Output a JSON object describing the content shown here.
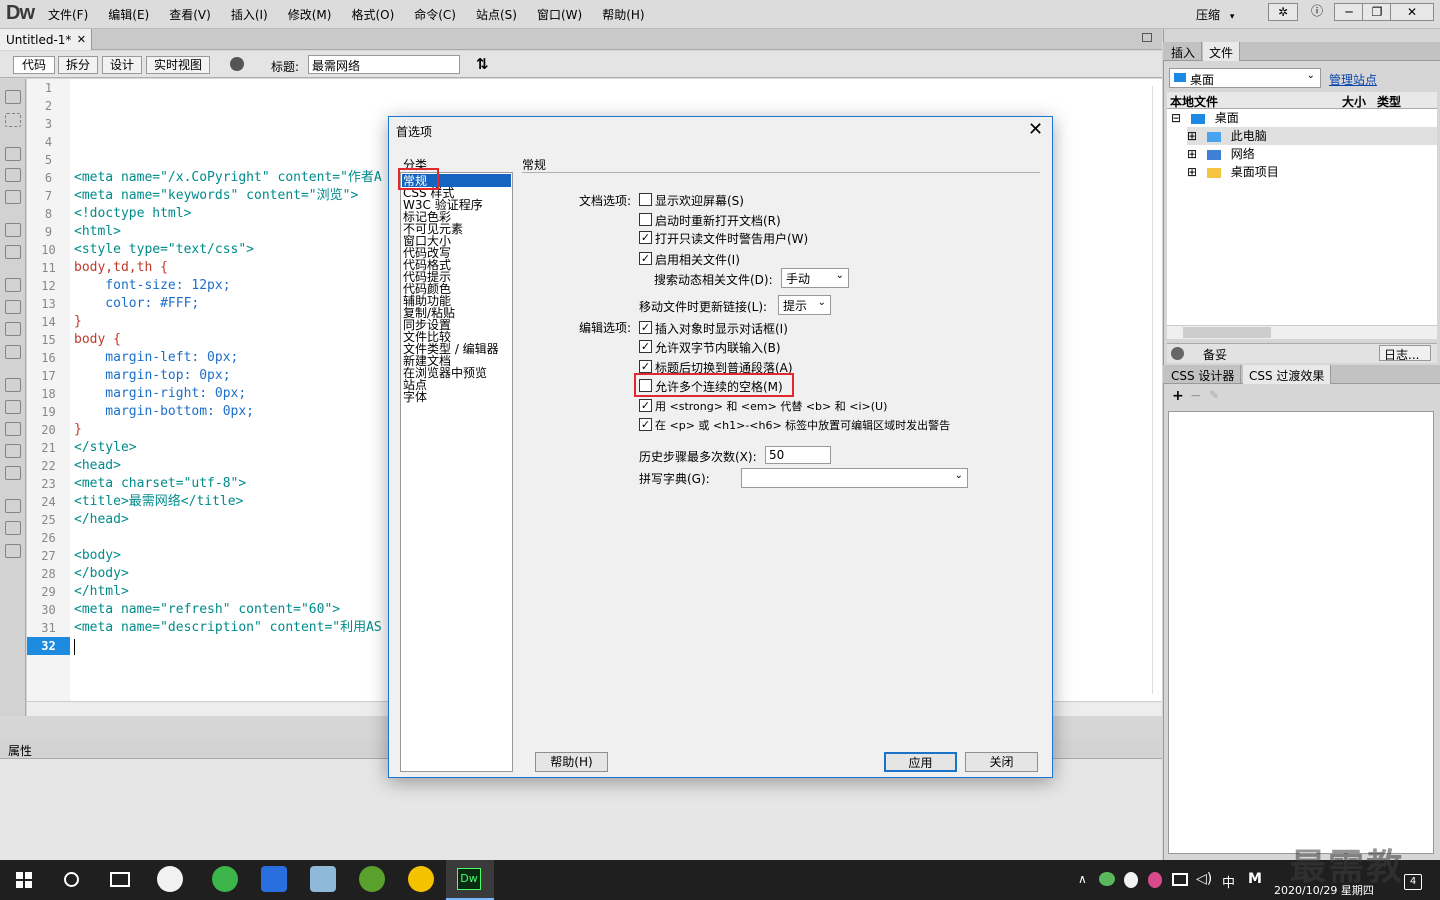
{
  "app": {
    "logo": "Dw",
    "menus": [
      "文件(F)",
      "编辑(E)",
      "查看(V)",
      "插入(I)",
      "修改(M)",
      "格式(O)",
      "命令(C)",
      "站点(S)",
      "窗口(W)",
      "帮助(H)"
    ],
    "compress_label": "压缩",
    "compress_arrow": "▾",
    "window_btns": [
      "✲",
      "ⓘ",
      "─",
      "❐",
      "✕"
    ]
  },
  "document": {
    "tab_name": "Untitled-1*",
    "tab_close": "✕",
    "view_buttons": [
      "代码",
      "拆分",
      "设计",
      "实时视图"
    ],
    "title_label": "标题:",
    "title_value": "最需网络"
  },
  "editor": {
    "line_numbers": [
      "1",
      "2",
      "3",
      "4",
      "5",
      "6",
      "7",
      "8",
      "9",
      "10",
      "11",
      "12",
      "13",
      "14",
      "15",
      "16",
      "17",
      "18",
      "19",
      "20",
      "21",
      "22",
      "23",
      "24",
      "25",
      "26",
      "27",
      "28",
      "29",
      "30",
      "31",
      "32"
    ],
    "current_line": "32",
    "lines": [
      "",
      "",
      "",
      "",
      "",
      "<meta name=\"/x.CoPyright\" content=\"作者A",
      "<meta name=\"keywords\" content=\"浏览\">",
      "<!doctype html>",
      "<html>",
      "<style type=\"text/css\">",
      "body,td,th {",
      "    font-size: 12px;",
      "    color: #FFF;",
      "}",
      "body {",
      "    margin-left: 0px;",
      "    margin-top: 0px;",
      "    margin-right: 0px;",
      "    margin-bottom: 0px;",
      "}",
      "</style>",
      "<head>",
      "<meta charset=\"utf-8\">",
      "<title>最需网络</title>",
      "</head>",
      "",
      "<body>",
      "</body>",
      "</html>",
      "<meta name=\"refresh\" content=\"60\">",
      "<meta name=\"description\" content=\"利用AS",
      ""
    ]
  },
  "properties_panel": {
    "title": "属性"
  },
  "right_panel": {
    "tabs": [
      "插入",
      "文件"
    ],
    "site_select": "桌面",
    "manage_sites": "管理站点",
    "file_headers": [
      "本地文件",
      "大小",
      "类型"
    ],
    "tree": [
      {
        "label": "桌面",
        "level": 0,
        "toggle": "⊟"
      },
      {
        "label": "此电脑",
        "level": 1,
        "toggle": "⊞"
      },
      {
        "label": "网络",
        "level": 1,
        "toggle": "⊞"
      },
      {
        "label": "桌面项目",
        "level": 1,
        "toggle": "⊞"
      }
    ],
    "status_left": "备妥",
    "status_right": "日志...",
    "css_tabs": [
      "CSS 设计器",
      "CSS 过渡效果"
    ],
    "css_toolbar": [
      "+",
      "−",
      "✎"
    ]
  },
  "dialog": {
    "title": "首选项",
    "close": "✕",
    "category_label": "分类",
    "categories": [
      "常规",
      "CSS 样式",
      "W3C 验证程序",
      "标记色彩",
      "不可见元素",
      "窗口大小",
      "代码改写",
      "代码格式",
      "代码提示",
      "代码颜色",
      "辅助功能",
      "复制/粘贴",
      "同步设置",
      "文件比较",
      "文件类型 / 编辑器",
      "新建文档",
      "在浏览器中预览",
      "站点",
      "字体"
    ],
    "section_title": "常规",
    "doc_options_label": "文档选项:",
    "doc_options": [
      {
        "label": "显示欢迎屏幕(S)",
        "checked": false
      },
      {
        "label": "启动时重新打开文档(R)",
        "checked": false
      },
      {
        "label": "打开只读文件时警告用户(W)",
        "checked": true
      },
      {
        "label": "启用相关文件(I)",
        "checked": true
      }
    ],
    "search_dynamic_label": "搜索动态相关文件(D):",
    "search_dynamic_value": "手动",
    "move_update_label": "移动文件时更新链接(L):",
    "move_update_value": "提示",
    "edit_options_label": "编辑选项:",
    "edit_options": [
      {
        "label": "插入对象时显示对话框(I)",
        "checked": true
      },
      {
        "label": "允许双字节内联输入(B)",
        "checked": true
      },
      {
        "label": "标题后切换到普通段落(A)",
        "checked": true
      },
      {
        "label": "允许多个连续的空格(M)",
        "checked": false
      },
      {
        "label": "用 <strong> 和 <em> 代替 <b> 和 <i>(U)",
        "checked": true
      },
      {
        "label": "在 <p> 或 <h1>-<h6> 标签中放置可编辑区域时发出警告",
        "checked": true
      }
    ],
    "history_label": "历史步骤最多次数(X):",
    "history_value": "50",
    "spell_label": "拼写字典(G):",
    "spell_value": "",
    "help_button": "帮助(H)",
    "apply_button": "应用",
    "close_button": "关闭"
  },
  "taskbar": {
    "ime": "中",
    "ime2": "M",
    "datetime": "2020/10/29 星期四",
    "notif_count": "4",
    "dw_label": "Dw"
  },
  "watermark": "最需教育"
}
